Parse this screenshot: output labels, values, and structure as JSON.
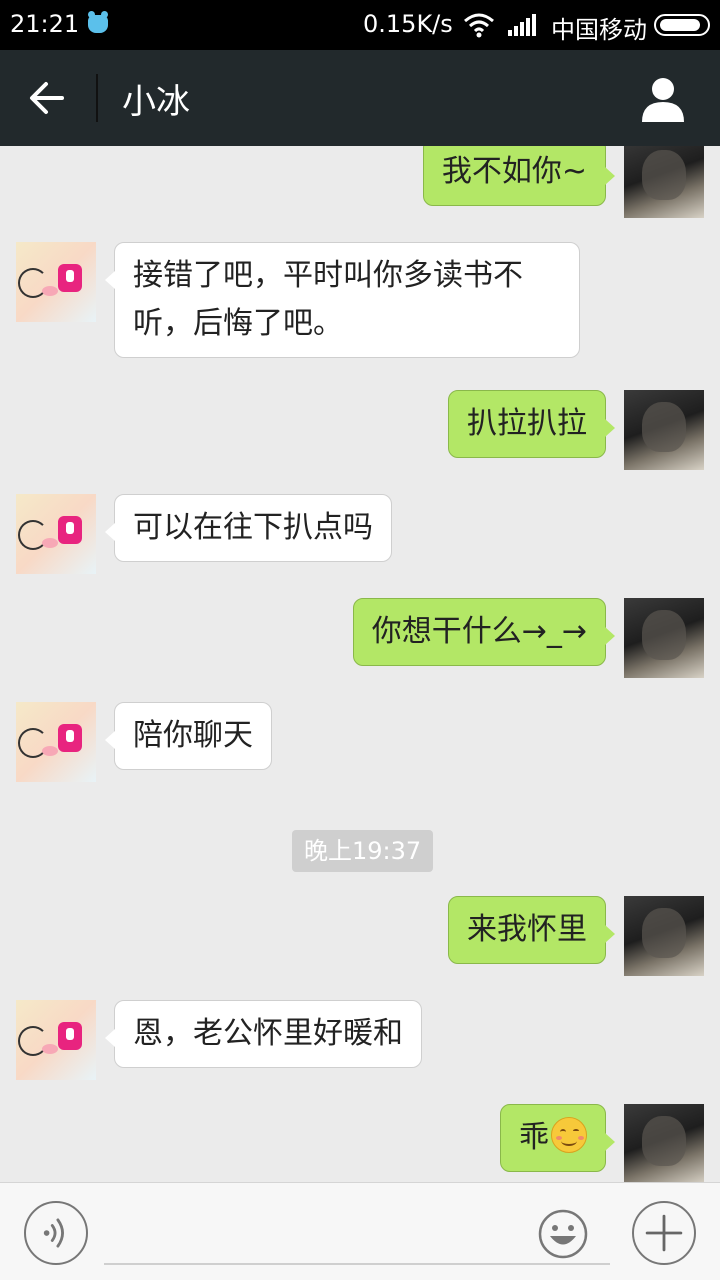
{
  "status_bar": {
    "time": "21:21",
    "speed": "0.15K/s",
    "carrier": "中国移动"
  },
  "header": {
    "title": "小冰"
  },
  "messages": [
    {
      "sender": "me",
      "text": "我不如你~"
    },
    {
      "sender": "bot",
      "text": "接错了吧，平时叫你多读书不听，后悔了吧。"
    },
    {
      "sender": "me",
      "text": "扒拉扒拉"
    },
    {
      "sender": "bot",
      "text": "可以在往下扒点吗"
    },
    {
      "sender": "me",
      "text": "你想干什么→_→"
    },
    {
      "sender": "bot",
      "text": "陪你聊天"
    },
    {
      "sender": "me",
      "text": "来我怀里"
    },
    {
      "sender": "bot",
      "text": "恩，老公怀里好暖和"
    },
    {
      "sender": "me",
      "text": "乖",
      "emoji": "smile-emoji"
    }
  ],
  "time_separator": "晚上19:37",
  "icons": {
    "back": "back-arrow-icon",
    "profile": "person-icon",
    "voice": "voice-icon",
    "emoji": "emoji-icon",
    "plus": "plus-icon"
  },
  "colors": {
    "title_bar": "#22292c",
    "my_bubble": "#b3e766",
    "bot_bubble": "#ffffff",
    "background": "#ebebeb"
  }
}
